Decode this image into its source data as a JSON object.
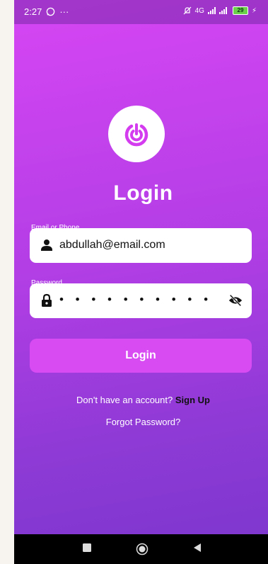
{
  "status_bar": {
    "time": "2:27",
    "extras": "···",
    "network": "4G",
    "battery": "29"
  },
  "icons": {
    "whatsapp": "whatsapp-icon",
    "mute": "mute-icon",
    "signal": "signal-icon",
    "battery": "battery-icon",
    "logo": "app-logo-icon",
    "user": "user-icon",
    "lock": "lock-icon",
    "visibility": "eye-off-icon",
    "nav_recent": "square-icon",
    "nav_home": "circle-icon",
    "nav_back": "back-triangle-icon"
  },
  "login": {
    "title": "Login",
    "email_label": "Email or Phone",
    "email_value": "abdullah@email.com",
    "password_label": "Password",
    "password_value": "• • • • • • • • • •",
    "button_label": "Login",
    "no_account_text": "Don't have an account?",
    "signup_link": "Sign Up",
    "forgot_password": "Forgot Password?"
  },
  "colors": {
    "gradient_top": "#d646f3",
    "gradient_bottom": "#7b37cd",
    "button": "#d84bf3",
    "logo_accent": "#d43cf0"
  }
}
